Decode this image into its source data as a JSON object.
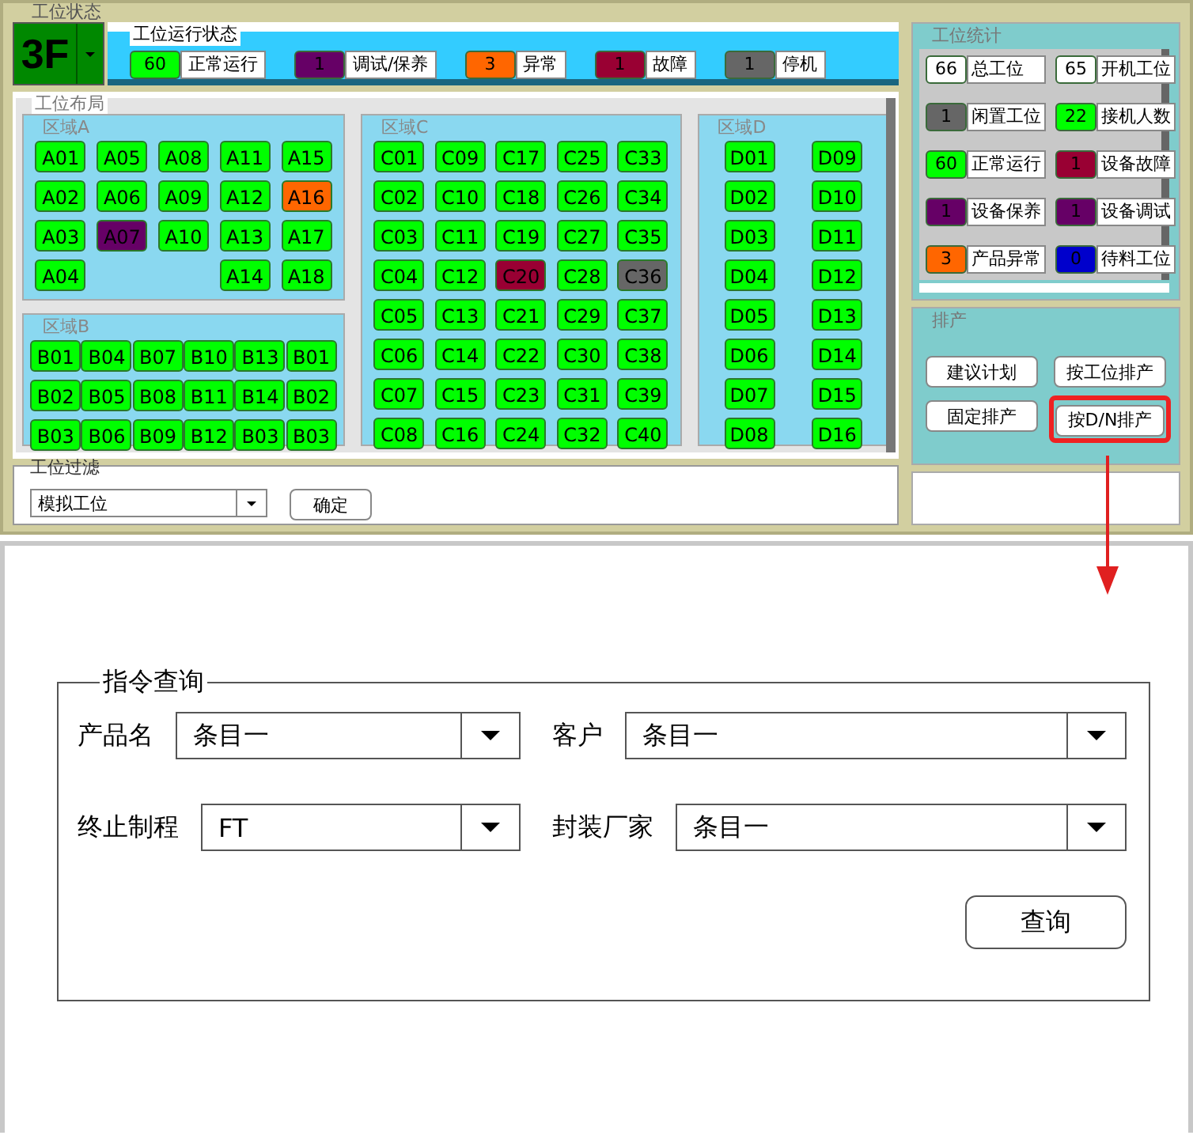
{
  "panel_title": "工位状态",
  "floor": {
    "value": "3F"
  },
  "run_status": {
    "title": "工位运行状态",
    "items": [
      {
        "count": "60",
        "label": "正常运行",
        "color": "#00ff00"
      },
      {
        "count": "1",
        "label": "调试/保养",
        "color": "#660066"
      },
      {
        "count": "3",
        "label": "异常",
        "color": "#ff6600"
      },
      {
        "count": "1",
        "label": "故障",
        "color": "#990033"
      },
      {
        "count": "1",
        "label": "停机",
        "color": "#666666"
      }
    ]
  },
  "layout": {
    "title": "工位布局",
    "zones": [
      {
        "name": "区域A",
        "columns": [
          [
            {
              "label": "A01",
              "color": "#00ff00"
            },
            {
              "label": "A02",
              "color": "#00ff00"
            },
            {
              "label": "A03",
              "color": "#00ff00"
            },
            {
              "label": "A04",
              "color": "#00ff00"
            }
          ],
          [
            {
              "label": "A05",
              "color": "#00ff00"
            },
            {
              "label": "A06",
              "color": "#00ff00"
            },
            {
              "label": "A07",
              "color": "#660066"
            }
          ],
          [
            {
              "label": "A08",
              "color": "#00ff00"
            },
            {
              "label": "A09",
              "color": "#00ff00"
            },
            {
              "label": "A10",
              "color": "#00ff00"
            }
          ],
          [
            {
              "label": "A11",
              "color": "#00ff00"
            },
            {
              "label": "A12",
              "color": "#00ff00"
            },
            {
              "label": "A13",
              "color": "#00ff00"
            },
            {
              "label": "A14",
              "color": "#00ff00"
            }
          ],
          [
            {
              "label": "A15",
              "color": "#00ff00"
            },
            {
              "label": "A16",
              "color": "#ff6600"
            },
            {
              "label": "A17",
              "color": "#00ff00"
            },
            {
              "label": "A18",
              "color": "#00ff00"
            }
          ]
        ]
      },
      {
        "name": "区域B",
        "columns": [
          [
            {
              "label": "B01",
              "color": "#00ff00"
            },
            {
              "label": "B02",
              "color": "#00ff00"
            },
            {
              "label": "B03",
              "color": "#00ff00"
            }
          ],
          [
            {
              "label": "B04",
              "color": "#00ff00"
            },
            {
              "label": "B05",
              "color": "#00ff00"
            },
            {
              "label": "B06",
              "color": "#00ff00"
            }
          ],
          [
            {
              "label": "B07",
              "color": "#00ff00"
            },
            {
              "label": "B08",
              "color": "#00ff00"
            },
            {
              "label": "B09",
              "color": "#00ff00"
            }
          ],
          [
            {
              "label": "B10",
              "color": "#00ff00"
            },
            {
              "label": "B11",
              "color": "#00ff00"
            },
            {
              "label": "B12",
              "color": "#00ff00"
            }
          ],
          [
            {
              "label": "B13",
              "color": "#00ff00"
            },
            {
              "label": "B14",
              "color": "#00ff00"
            },
            {
              "label": "B03",
              "color": "#00ff00"
            }
          ],
          [
            {
              "label": "B01",
              "color": "#00ff00"
            },
            {
              "label": "B02",
              "color": "#00ff00"
            },
            {
              "label": "B03",
              "color": "#00ff00"
            }
          ]
        ]
      },
      {
        "name": "区域C",
        "columns": [
          [
            {
              "label": "C01",
              "color": "#00ff00"
            },
            {
              "label": "C02",
              "color": "#00ff00"
            },
            {
              "label": "C03",
              "color": "#00ff00"
            },
            {
              "label": "C04",
              "color": "#00ff00"
            },
            {
              "label": "C05",
              "color": "#00ff00"
            },
            {
              "label": "C06",
              "color": "#00ff00"
            },
            {
              "label": "C07",
              "color": "#00ff00"
            },
            {
              "label": "C08",
              "color": "#00ff00"
            }
          ],
          [
            {
              "label": "C09",
              "color": "#00ff00"
            },
            {
              "label": "C10",
              "color": "#00ff00"
            },
            {
              "label": "C11",
              "color": "#00ff00"
            },
            {
              "label": "C12",
              "color": "#00ff00"
            },
            {
              "label": "C13",
              "color": "#00ff00"
            },
            {
              "label": "C14",
              "color": "#00ff00"
            },
            {
              "label": "C15",
              "color": "#00ff00"
            },
            {
              "label": "C16",
              "color": "#00ff00"
            }
          ],
          [
            {
              "label": "C17",
              "color": "#00ff00"
            },
            {
              "label": "C18",
              "color": "#00ff00"
            },
            {
              "label": "C19",
              "color": "#00ff00"
            },
            {
              "label": "C20",
              "color": "#990033"
            },
            {
              "label": "C21",
              "color": "#00ff00"
            },
            {
              "label": "C22",
              "color": "#00ff00"
            },
            {
              "label": "C23",
              "color": "#00ff00"
            },
            {
              "label": "C24",
              "color": "#00ff00"
            }
          ],
          [
            {
              "label": "C25",
              "color": "#00ff00"
            },
            {
              "label": "C26",
              "color": "#00ff00"
            },
            {
              "label": "C27",
              "color": "#00ff00"
            },
            {
              "label": "C28",
              "color": "#00ff00"
            },
            {
              "label": "C29",
              "color": "#00ff00"
            },
            {
              "label": "C30",
              "color": "#00ff00"
            },
            {
              "label": "C31",
              "color": "#00ff00"
            },
            {
              "label": "C32",
              "color": "#00ff00"
            }
          ],
          [
            {
              "label": "C33",
              "color": "#00ff00"
            },
            {
              "label": "C34",
              "color": "#00ff00"
            },
            {
              "label": "C35",
              "color": "#00ff00"
            },
            {
              "label": "C36",
              "color": "#666666"
            },
            {
              "label": "C37",
              "color": "#00ff00"
            },
            {
              "label": "C38",
              "color": "#00ff00"
            },
            {
              "label": "C39",
              "color": "#00ff00"
            },
            {
              "label": "C40",
              "color": "#00ff00"
            }
          ]
        ]
      },
      {
        "name": "区域D",
        "columns": [
          [
            {
              "label": "D01",
              "color": "#00ff00"
            },
            {
              "label": "D02",
              "color": "#00ff00"
            },
            {
              "label": "D03",
              "color": "#00ff00"
            },
            {
              "label": "D04",
              "color": "#00ff00"
            },
            {
              "label": "D05",
              "color": "#00ff00"
            },
            {
              "label": "D06",
              "color": "#00ff00"
            },
            {
              "label": "D07",
              "color": "#00ff00"
            },
            {
              "label": "D08",
              "color": "#00ff00"
            }
          ],
          [
            {
              "label": "D09",
              "color": "#00ff00"
            },
            {
              "label": "D10",
              "color": "#00ff00"
            },
            {
              "label": "D11",
              "color": "#00ff00"
            },
            {
              "label": "D12",
              "color": "#00ff00"
            },
            {
              "label": "D13",
              "color": "#00ff00"
            },
            {
              "label": "D14",
              "color": "#00ff00"
            },
            {
              "label": "D15",
              "color": "#00ff00"
            },
            {
              "label": "D16",
              "color": "#00ff00"
            }
          ]
        ]
      }
    ]
  },
  "filter": {
    "title": "工位过滤",
    "value": "模拟工位",
    "button": "确定"
  },
  "stats": {
    "title": "工位统计",
    "items": [
      {
        "count": "66",
        "label": "总工位",
        "color": "#ffffff"
      },
      {
        "count": "65",
        "label": "开机工位",
        "color": "#ffffff"
      },
      {
        "count": "1",
        "label": "闲置工位",
        "color": "#666666"
      },
      {
        "count": "22",
        "label": "接机人数",
        "color": "#00ff00"
      },
      {
        "count": "60",
        "label": "正常运行",
        "color": "#00ff00"
      },
      {
        "count": "1",
        "label": "设备故障",
        "color": "#990033"
      },
      {
        "count": "1",
        "label": "设备保养",
        "color": "#660066"
      },
      {
        "count": "1",
        "label": "设备调试",
        "color": "#660066"
      },
      {
        "count": "3",
        "label": "产品异常",
        "color": "#ff6600"
      },
      {
        "count": "0",
        "label": "待料工位",
        "color": "#0000cc"
      }
    ]
  },
  "scheduling": {
    "title": "排产",
    "buttons": [
      {
        "label": "建议计划",
        "highlighted": false
      },
      {
        "label": "按工位排产",
        "highlighted": false
      },
      {
        "label": "固定排产",
        "highlighted": false
      },
      {
        "label": "按D/N排产",
        "highlighted": true
      }
    ]
  },
  "query": {
    "title": "指令查询",
    "fields": [
      {
        "label": "产品名",
        "value": "条目一"
      },
      {
        "label": "客户",
        "value": "条目一"
      },
      {
        "label": "终止制程",
        "value": "FT"
      },
      {
        "label": "封装厂家",
        "value": "条目一"
      }
    ],
    "button": "查询"
  }
}
